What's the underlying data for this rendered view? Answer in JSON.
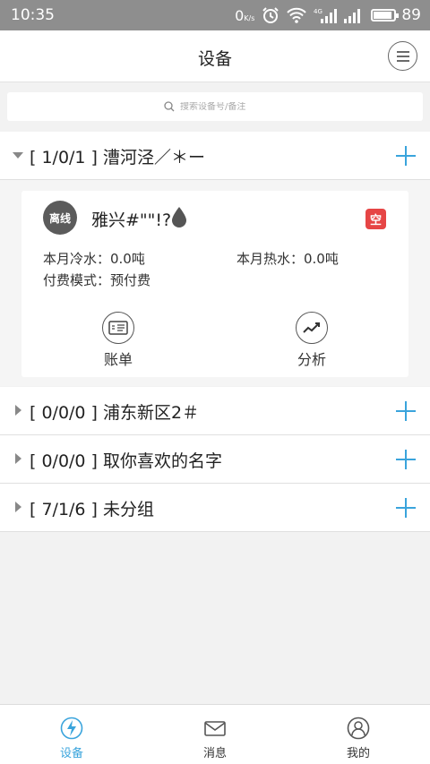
{
  "status_bar": {
    "time": "10:35",
    "network_speed": "0",
    "speed_unit": "K/s",
    "battery": "89",
    "battery_level": 0.89
  },
  "header": {
    "title": "设备"
  },
  "search": {
    "placeholder": "搜索设备号/备注"
  },
  "groups": [
    {
      "label": "[ 1/0/1 ] 漕河泾／＊ー",
      "expanded": true
    },
    {
      "label": "[ 0/0/0 ] 浦东新区2＃",
      "expanded": false
    },
    {
      "label": "[ 0/0/0 ] 取你喜欢的名字",
      "expanded": false
    },
    {
      "label": "[ 7/1/6 ] 未分组",
      "expanded": false
    }
  ],
  "device": {
    "status_badge": "离线",
    "name": "雅兴#\"\"!?",
    "type_badge": "空",
    "cold_water": "本月冷水：0.0吨",
    "hot_water": "本月热水：0.0吨",
    "payment_mode": "付费模式：预付费",
    "actions": [
      {
        "label": "账单",
        "icon": "bill-icon"
      },
      {
        "label": "分析",
        "icon": "analysis-icon"
      }
    ]
  },
  "bottom_nav": [
    {
      "label": "设备",
      "icon": "lightning-icon",
      "active": true,
      "color": "#3aa4dc"
    },
    {
      "label": "消息",
      "icon": "mail-icon",
      "active": false
    },
    {
      "label": "我的",
      "icon": "user-icon",
      "active": false
    }
  ],
  "colors": {
    "accent": "#3aa4dc",
    "badge_red": "#e64545",
    "avatar_gray": "#5b5b5b"
  }
}
